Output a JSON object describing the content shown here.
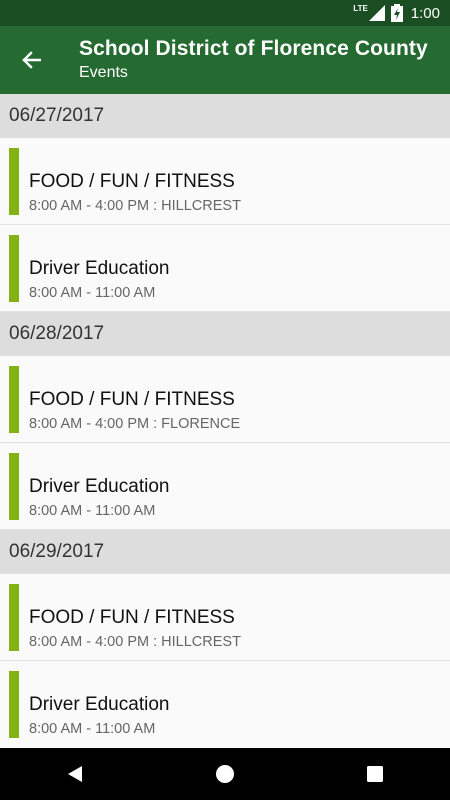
{
  "status_bar": {
    "network": "LTE",
    "time": "1:00"
  },
  "app_bar": {
    "title": "School District of Florence County",
    "subtitle": "Events"
  },
  "sections": [
    {
      "date": "06/27/2017",
      "events": [
        {
          "name": "FOOD / FUN / FITNESS",
          "detail": "8:00 AM - 4:00 PM : HILLCREST"
        },
        {
          "name": "Driver Education",
          "detail": "8:00 AM - 11:00 AM"
        }
      ]
    },
    {
      "date": "06/28/2017",
      "events": [
        {
          "name": "FOOD / FUN / FITNESS",
          "detail": "8:00 AM - 4:00 PM : FLORENCE"
        },
        {
          "name": "Driver Education",
          "detail": "8:00 AM - 11:00 AM"
        }
      ]
    },
    {
      "date": "06/29/2017",
      "events": [
        {
          "name": "FOOD / FUN / FITNESS",
          "detail": "8:00 AM - 4:00 PM : HILLCREST"
        },
        {
          "name": "Driver Education",
          "detail": "8:00 AM - 11:00 AM"
        }
      ]
    }
  ],
  "colors": {
    "status_bar": "#1b4d22",
    "app_bar": "#256a30",
    "event_accent": "#82b213",
    "date_header": "#dddddd"
  },
  "icons": {
    "back": "arrow-left-icon",
    "nav_back": "triangle-back-icon",
    "nav_home": "circle-home-icon",
    "nav_recents": "square-recents-icon"
  }
}
